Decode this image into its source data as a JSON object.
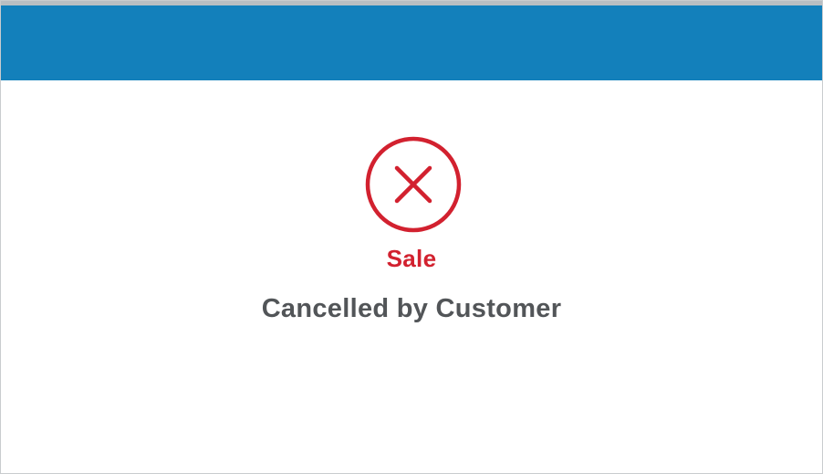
{
  "header": {
    "color": "#1380bb"
  },
  "status": {
    "icon": "cancel-circle-icon",
    "icon_color": "#d2212f",
    "title": "Sale",
    "message": "Cancelled by Customer"
  }
}
